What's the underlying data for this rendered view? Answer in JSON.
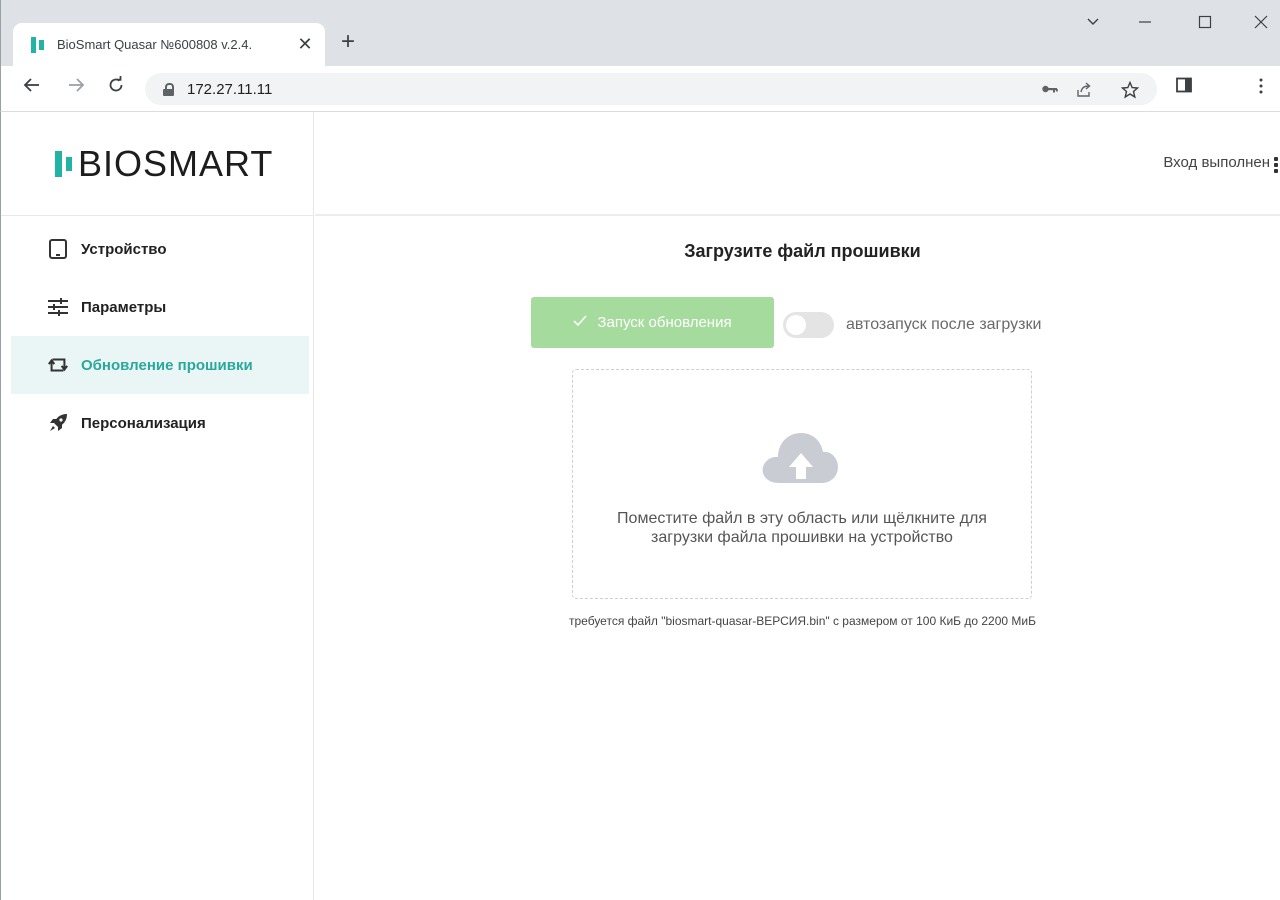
{
  "browser": {
    "tab_title": "BioSmart Quasar №600808 v.2.4.",
    "url": "172.27.11.11",
    "new_tab": "+",
    "close_tab": "✕"
  },
  "app": {
    "logo_text": "BIOSMART",
    "user_status": "Вход выполнен",
    "menu": [
      {
        "label": "Устройство",
        "icon": "tablet-icon"
      },
      {
        "label": "Параметры",
        "icon": "sliders-icon"
      },
      {
        "label": "Обновление прошивки",
        "icon": "sync-icon",
        "active": true
      },
      {
        "label": "Персонализация",
        "icon": "rocket-icon"
      }
    ],
    "accent_color": "#23b3a4"
  },
  "main": {
    "title": "Загрузите файл прошивки",
    "update_button_label": "Запуск обновления",
    "autostart_label": "автозапуск после загрузки",
    "autostart_enabled": false,
    "dropzone_text_1": "Поместите файл в эту область или щёлкните для",
    "dropzone_text_2": "загрузки файла прошивки на устройство",
    "file_hint": "требуется файл \"biosmart-quasar-ВЕРСИЯ.bin\" с размером от 100 КиБ до 2200 МиБ"
  }
}
